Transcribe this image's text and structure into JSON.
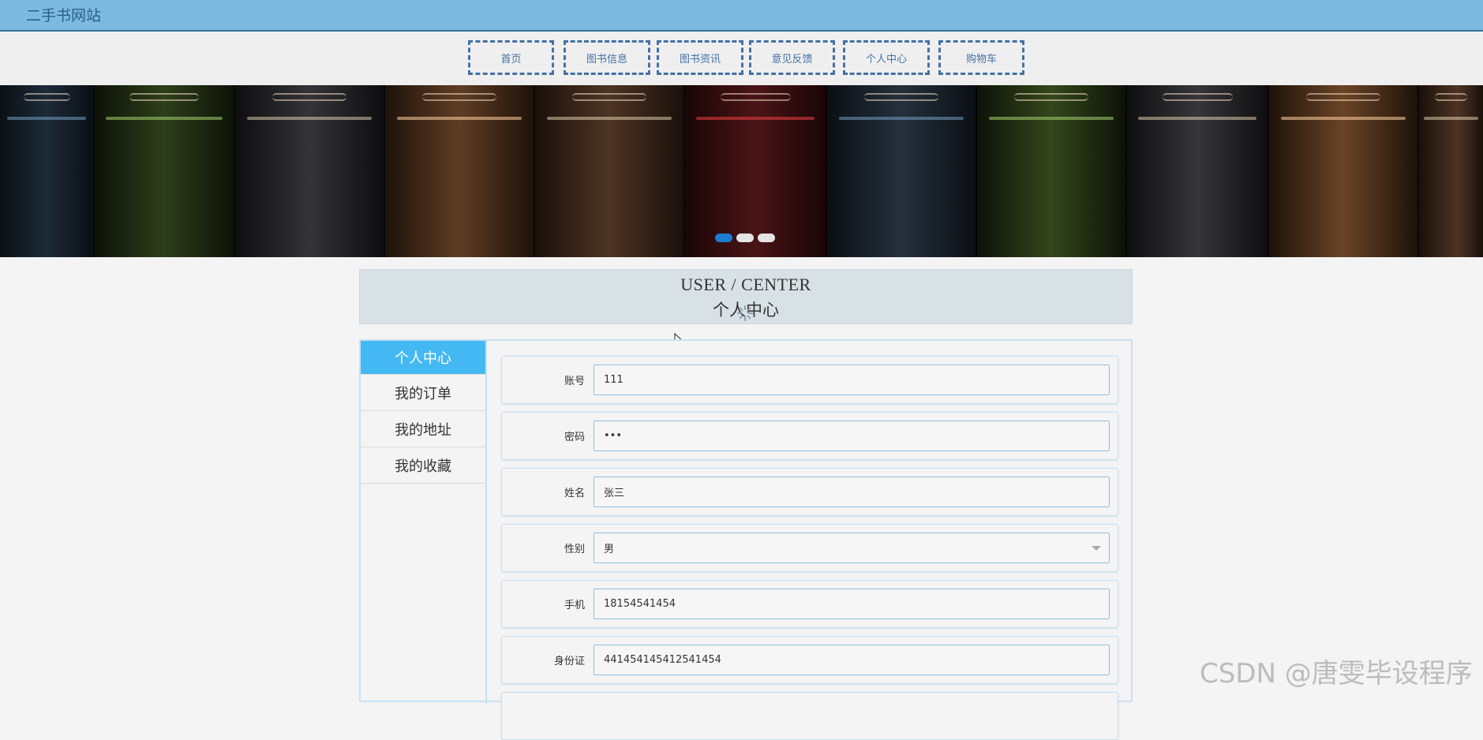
{
  "site": {
    "title": "二手书网站"
  },
  "nav": {
    "items": [
      {
        "label": "首页"
      },
      {
        "label": "图书信息"
      },
      {
        "label": "图书资讯"
      },
      {
        "label": "意见反馈"
      },
      {
        "label": "个人中心"
      },
      {
        "label": "购物车"
      }
    ]
  },
  "banner": {
    "active_slide": 1,
    "slide_count": 3
  },
  "section": {
    "title_en": "USER / CENTER",
    "title_zh": "个人中心"
  },
  "sidebar": {
    "items": [
      {
        "label": "个人中心",
        "active": true
      },
      {
        "label": "我的订单",
        "active": false
      },
      {
        "label": "我的地址",
        "active": false
      },
      {
        "label": "我的收藏",
        "active": false
      }
    ]
  },
  "form": {
    "fields": [
      {
        "label": "账号",
        "value": "111"
      },
      {
        "label": "密码",
        "value": "•••"
      },
      {
        "label": "姓名",
        "value": "张三"
      },
      {
        "label": "性别",
        "value": "男"
      },
      {
        "label": "手机",
        "value": "18154541454"
      },
      {
        "label": "身份证",
        "value": "441454145412541454"
      }
    ]
  },
  "watermark": "CSDN @唐雯毕设程序",
  "colors": {
    "topbar": "#7dbae0",
    "nav_border": "#4471a4",
    "sidebar_active": "#44b8f2",
    "dot_active": "#1a7dd1"
  }
}
